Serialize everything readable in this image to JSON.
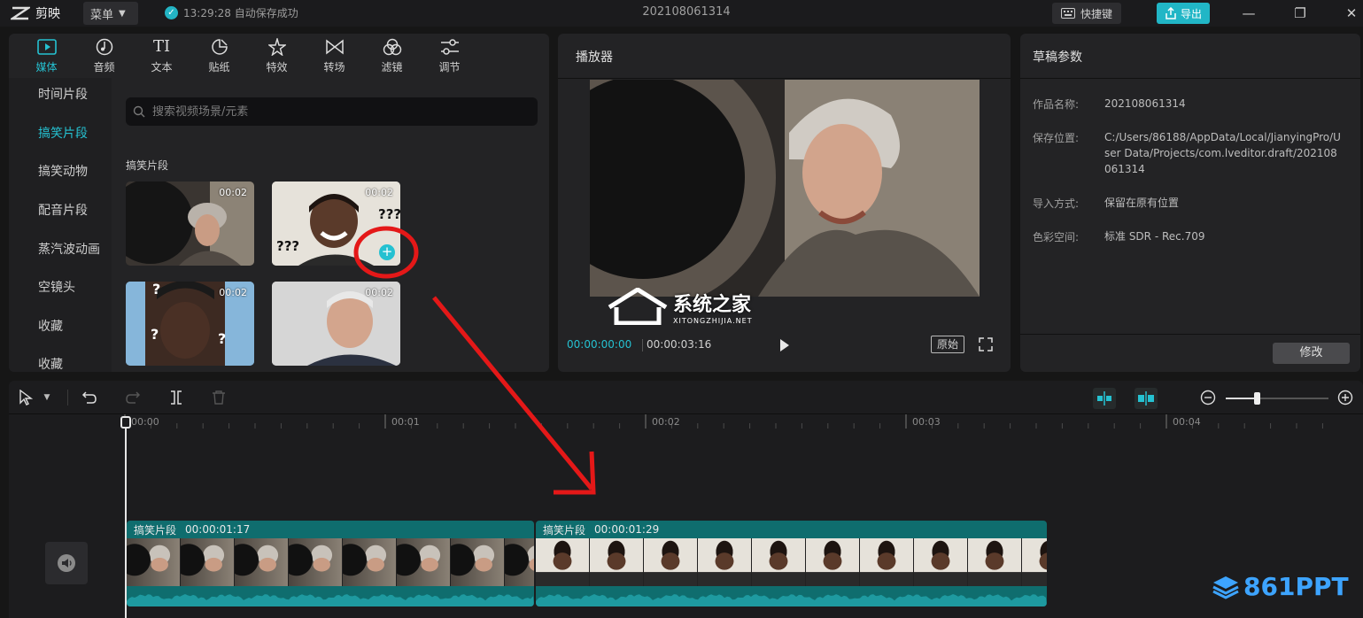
{
  "app": {
    "name": "剪映",
    "menu_label": "菜单",
    "save_status": "13:29:28 自动保存成功",
    "document_title": "202108061314",
    "shortcut_label": "快捷键",
    "export_label": "导出",
    "accent_color": "#25c1d1"
  },
  "media_toolbar": {
    "tabs": [
      {
        "label": "媒体",
        "icon": "media-icon"
      },
      {
        "label": "音频",
        "icon": "audio-icon"
      },
      {
        "label": "文本",
        "icon": "text-icon"
      },
      {
        "label": "贴纸",
        "icon": "sticker-icon"
      },
      {
        "label": "特效",
        "icon": "effects-icon"
      },
      {
        "label": "转场",
        "icon": "transition-icon"
      },
      {
        "label": "滤镜",
        "icon": "filter-icon"
      },
      {
        "label": "调节",
        "icon": "adjust-icon"
      }
    ],
    "active_tab": "媒体"
  },
  "media_sidebar": {
    "items": [
      "时间片段",
      "搞笑片段",
      "搞笑动物",
      "配音片段",
      "蒸汽波动画",
      "空镜头",
      "收藏",
      "收藏"
    ],
    "active_item": "搞笑片段"
  },
  "media_library": {
    "search_placeholder": "搜索视频场景/元素",
    "section_title": "搞笑片段",
    "thumbnails": [
      {
        "duration": "00:02"
      },
      {
        "duration": "00:02"
      },
      {
        "duration": "00:02"
      },
      {
        "duration": "00:02"
      }
    ]
  },
  "player": {
    "title": "播放器",
    "current_time": "00:00:00:00",
    "total_time": "00:00:03:16",
    "ratio_label": "原始"
  },
  "draft": {
    "title": "草稿参数",
    "properties": [
      {
        "label": "作品名称:",
        "value": "202108061314"
      },
      {
        "label": "保存位置:",
        "value": "C:/Users/86188/AppData/Local/JianyingPro/User Data/Projects/com.lveditor.draft/202108061314"
      },
      {
        "label": "导入方式:",
        "value": "保留在原有位置"
      },
      {
        "label": "色彩空间:",
        "value": "标准 SDR - Rec.709"
      }
    ],
    "modify_label": "修改"
  },
  "timeline": {
    "ruler_labels": [
      "00:00",
      "00:01",
      "00:02",
      "00:03",
      "00:04"
    ],
    "clips": [
      {
        "name": "搞笑片段",
        "duration": "00:00:01:17"
      },
      {
        "name": "搞笑片段",
        "duration": "00:00:01:29"
      }
    ]
  },
  "watermarks": {
    "center_text": "系统之家",
    "center_site": "XITONGZHIJIA.NET",
    "corner_text": "861PPT"
  }
}
